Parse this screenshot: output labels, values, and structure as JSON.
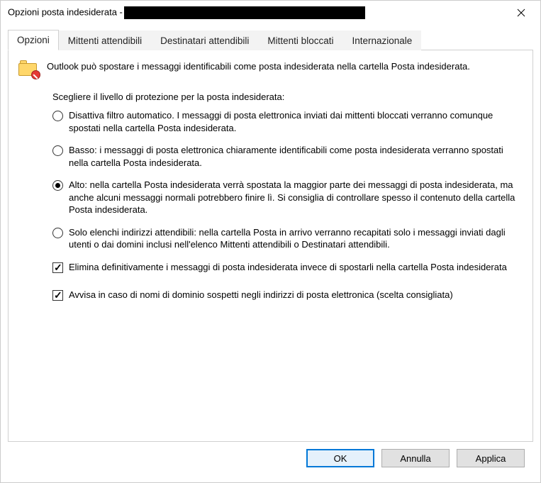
{
  "window": {
    "title_prefix": "Opzioni posta indesiderata -"
  },
  "tabs": {
    "opzioni": "Opzioni",
    "mittenti_att": "Mittenti attendibili",
    "destinatari_att": "Destinatari attendibili",
    "mittenti_bloc": "Mittenti bloccati",
    "internazionale": "Internazionale",
    "active_index": 0
  },
  "panel": {
    "intro": "Outlook può spostare i messaggi identificabili come posta indesiderata nella cartella Posta indesiderata.",
    "choose_level": "Scegliere il livello di protezione per la posta indesiderata:",
    "radios": {
      "disattiva": "Disattiva filtro automatico. I messaggi di posta elettronica inviati dai mittenti bloccati verranno comunque spostati nella cartella Posta indesiderata.",
      "basso": "Basso: i messaggi di posta elettronica chiaramente identificabili come posta indesiderata verranno spostati nella cartella Posta indesiderata.",
      "alto": "Alto: nella cartella Posta indesiderata verrà spostata la maggior parte dei messaggi di posta indesiderata, ma anche alcuni messaggi normali potrebbero finire lì. Si consiglia di controllare spesso il contenuto della cartella Posta indesiderata.",
      "solo_elenchi": "Solo elenchi indirizzi attendibili: nella cartella Posta in arrivo verranno recapitati solo i messaggi inviati dagli utenti o dai domini inclusi nell'elenco Mittenti attendibili o Destinatari attendibili.",
      "selected": "alto"
    },
    "checks": {
      "elimina": {
        "label": "Elimina definitivamente i messaggi di posta indesiderata invece di spostarli nella cartella Posta indesiderata",
        "checked": true
      },
      "avvisa": {
        "label": "Avvisa in caso di nomi di dominio sospetti negli indirizzi di posta elettronica (scelta consigliata)",
        "checked": true
      }
    }
  },
  "buttons": {
    "ok": "OK",
    "cancel": "Annulla",
    "apply": "Applica"
  }
}
